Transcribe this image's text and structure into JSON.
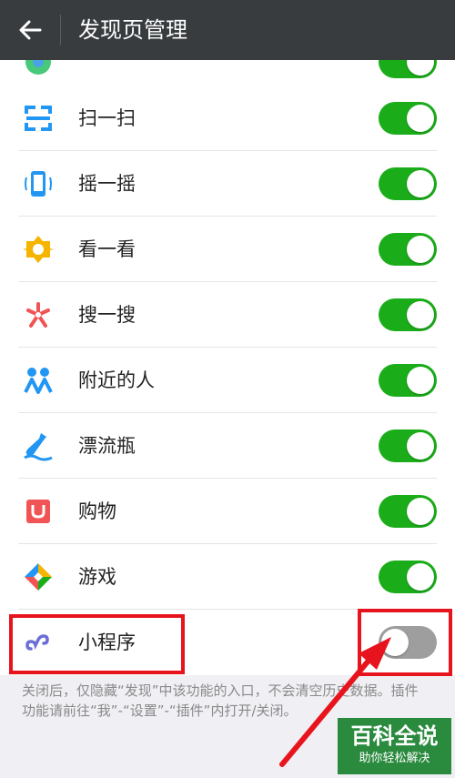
{
  "header": {
    "title": "发现页管理",
    "back_icon": "arrow-left-icon"
  },
  "items": [
    {
      "label": "扫一扫",
      "icon": "scan-icon",
      "enabled": true
    },
    {
      "label": "摇一摇",
      "icon": "shake-icon",
      "enabled": true
    },
    {
      "label": "看一看",
      "icon": "top-stories-icon",
      "enabled": true
    },
    {
      "label": "搜一搜",
      "icon": "search-icon",
      "enabled": true
    },
    {
      "label": "附近的人",
      "icon": "people-nearby-icon",
      "enabled": true
    },
    {
      "label": "漂流瓶",
      "icon": "drift-bottle-icon",
      "enabled": true
    },
    {
      "label": "购物",
      "icon": "shopping-icon",
      "enabled": true
    },
    {
      "label": "游戏",
      "icon": "games-icon",
      "enabled": true
    },
    {
      "label": "小程序",
      "icon": "mini-program-icon",
      "enabled": false
    }
  ],
  "footer_note": "关闭后，仅隐藏“发现”中该功能的入口，不会清空历史数据。插件功能请前往“我”-“设置”-“插件”内打开/关闭。",
  "watermark": {
    "main": "百科全说",
    "sub": "助你轻松解决"
  },
  "colors": {
    "toggle_on": "#1aad19",
    "toggle_off": "#9e9e9e",
    "highlight": "#e8141d",
    "topbar": "#383c3f"
  }
}
